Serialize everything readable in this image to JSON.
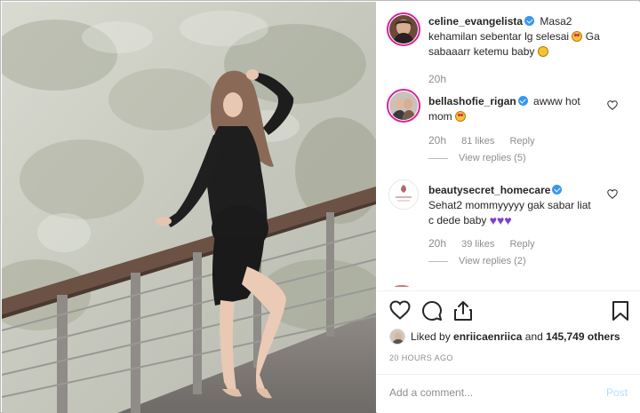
{
  "post": {
    "author": "celine_evangelista",
    "caption_line1": "Masa2",
    "caption_line2": "kehamilan sebentar lg selesai",
    "caption_tail": "Ga",
    "caption_line3": "sabaaarr ketemu baby",
    "caption_time": "20h"
  },
  "comments": [
    {
      "user": "bellashofie_rigan",
      "text_line1": "awww hot",
      "text_line2": "mom",
      "time": "20h",
      "likes": "81 likes",
      "reply": "Reply",
      "view_replies": "View replies (5)"
    },
    {
      "user": "beautysecret_homecare",
      "text_line1": "Sehat2 mommyyyyy gak sabar liat",
      "text_line2": "c dede baby",
      "time": "20h",
      "likes": "39 likes",
      "reply": "Reply",
      "view_replies": "View replies (2)"
    }
  ],
  "footer": {
    "liked_by_prefix": "Liked by",
    "liked_by_user": "enriicaenriica",
    "liked_by_joiner": "and",
    "liked_by_count": "145,749 others",
    "timestamp": "20 HOURS AGO",
    "add_comment_placeholder": "Add a comment...",
    "post_label": "Post"
  },
  "icons": {
    "like": "heart-icon",
    "comment": "speech-bubble-icon",
    "share": "share-icon",
    "save": "bookmark-icon",
    "verified": "verified-badge-icon"
  },
  "colors": {
    "verified": "#3897f0",
    "post_button": "#b2dffc",
    "muted_text": "#8e8e8e",
    "story_ring": "#d6249f"
  }
}
